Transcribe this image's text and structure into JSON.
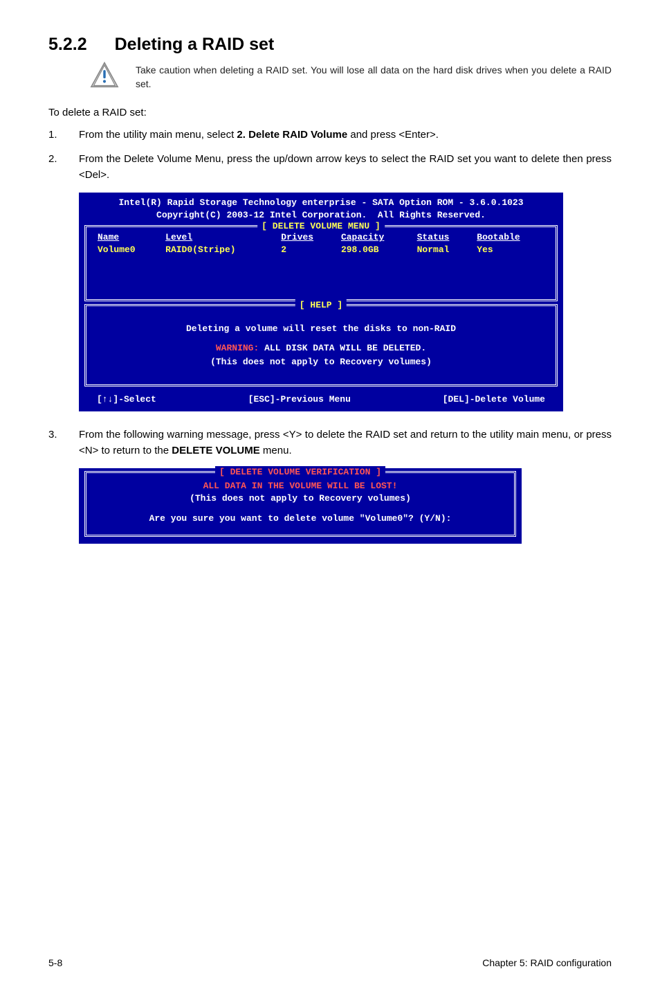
{
  "heading": {
    "num": "5.2.2",
    "text": "Deleting a RAID set"
  },
  "caution": "Take caution when deleting a RAID set. You will lose all data on the hard disk drives when you delete a RAID set.",
  "lead": "To delete a RAID set:",
  "steps": {
    "s1_a": "From the utility main menu, select ",
    "s1_b": "2. Delete RAID Volume",
    "s1_c": " and press <Enter>.",
    "s2": "From the Delete Volume Menu, press the up/down arrow keys to select the RAID set you want to delete then press <Del>.",
    "s3_a": "From the following warning message, press <Y> to delete the RAID set and return to the utility main menu, or press <N> to return to the ",
    "s3_b": "DELETE VOLUME",
    "s3_c": " menu."
  },
  "bios1": {
    "header1": "Intel(R) Rapid Storage Technology enterprise - SATA Option ROM - 3.6.0.1023",
    "header2": "Copyright(C) 2003-12 Intel Corporation.  All Rights Reserved.",
    "menu_title": "[ DELETE VOLUME MENU ]",
    "cols": {
      "c1": "Name",
      "c2": "Level",
      "c3": "Drives",
      "c4": "Capacity",
      "c5": "Status",
      "c6": "Bootable"
    },
    "row": {
      "c1": "Volume0",
      "c2": "RAID0(Stripe)",
      "c3": "2",
      "c4": "298.0GB",
      "c5": "Normal",
      "c6": "Yes"
    },
    "help_title": "[ HELP ]",
    "help1": "Deleting a volume will reset the disks to non-RAID",
    "help2_warn": "WARNING:",
    "help2_rest": " ALL DISK DATA WILL BE DELETED.",
    "help3": "(This does not apply to Recovery volumes)",
    "foot1": "[↑↓]-Select",
    "foot2": "[ESC]-Previous Menu",
    "foot3": "[DEL]-Delete Volume"
  },
  "bios2": {
    "title": "[ DELETE VOLUME VERIFICATION ]",
    "l1": "ALL DATA IN THE VOLUME WILL BE LOST!",
    "l2": "(This does not apply to Recovery volumes)",
    "l3": "Are you sure you want to delete volume \"Volume0\"? (Y/N):"
  },
  "footer": {
    "left": "5-8",
    "right": "Chapter 5: RAID configuration"
  }
}
